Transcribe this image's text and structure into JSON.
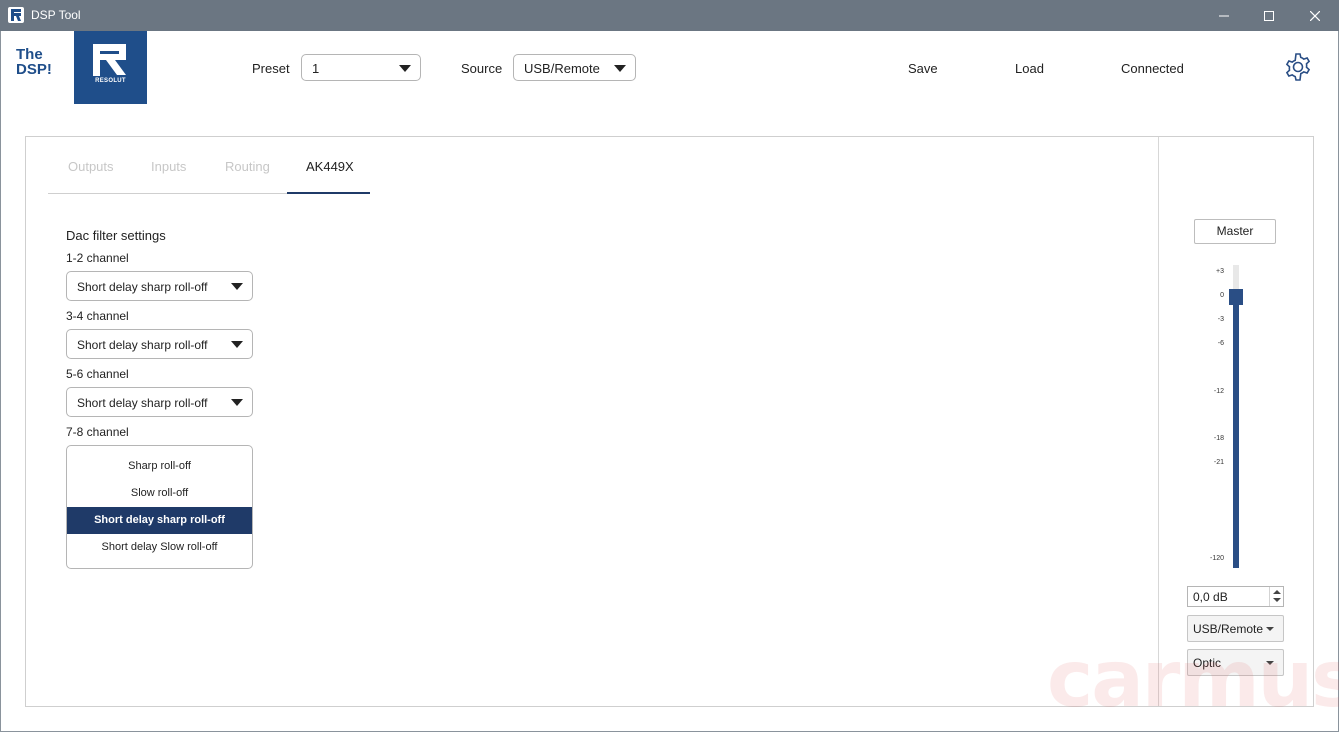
{
  "window": {
    "title": "DSP Tool",
    "controls": [
      "minimize",
      "maximize",
      "close"
    ]
  },
  "brand": {
    "tagline_line1": "The",
    "tagline_line2": "DSP!",
    "logo_text": "RESOLUT",
    "color": "#1f4e8a"
  },
  "header": {
    "preset_label": "Preset",
    "preset_value": "1",
    "source_label": "Source",
    "source_value": "USB/Remote",
    "save_label": "Save",
    "load_label": "Load",
    "status": "Connected",
    "settings_icon": "gear-icon"
  },
  "tabs": [
    {
      "label": "Outputs",
      "active": false
    },
    {
      "label": "Inputs",
      "active": false
    },
    {
      "label": "Routing",
      "active": false
    },
    {
      "label": "AK449X",
      "active": true
    }
  ],
  "dac": {
    "title": "Dac filter settings",
    "channels": [
      {
        "label": "1-2 channel",
        "value": "Short delay sharp roll-off"
      },
      {
        "label": "3-4 channel",
        "value": "Short delay sharp roll-off"
      },
      {
        "label": "5-6 channel",
        "value": "Short delay sharp roll-off"
      },
      {
        "label": "7-8 channel",
        "value": "Short delay sharp roll-off"
      }
    ],
    "open_options": [
      "Sharp roll-off",
      "Slow roll-off",
      "Short delay sharp roll-off",
      "Short delay Slow roll-off"
    ],
    "selected_option": "Short delay sharp roll-off"
  },
  "master": {
    "label": "Master",
    "scale": [
      "+3",
      "0",
      "-3",
      "-6",
      "-12",
      "-18",
      "-21",
      "-120"
    ],
    "level_db": 0,
    "value_text": "0,0 dB",
    "source_value": "USB/Remote",
    "input_value": "Optic",
    "accent": "#2a4e85"
  },
  "watermark": "carmus"
}
